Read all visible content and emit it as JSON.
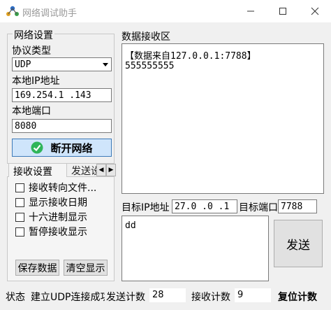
{
  "window": {
    "title": "网络调试助手"
  },
  "network_settings": {
    "group_title": "网络设置",
    "protocol_label": "协议类型",
    "protocol_value": "UDP",
    "local_ip_label": "本地IP地址",
    "local_ip_value": "169.254.1  .143",
    "local_port_label": "本地端口",
    "local_port_value": "8080",
    "connect_button": "断开网络"
  },
  "receive_settings": {
    "tab_active": "接收设置",
    "tab_inactive": "发送设置",
    "options": [
      "接收转向文件...",
      "显示接收日期",
      "十六进制显示",
      "暂停接收显示"
    ],
    "save_button": "保存数据",
    "clear_button": "清空显示"
  },
  "receive_area": {
    "title": "数据接收区",
    "lines": [
      "【数据来自127.0.0.1:7788】",
      "555555555"
    ]
  },
  "target": {
    "ip_label": "目标IP地址",
    "ip_value": "27.0  .0  .1",
    "port_label": "目标端口",
    "port_value": "7788"
  },
  "send_area": {
    "text": "dd",
    "send_button": "发送"
  },
  "status_bar": {
    "status_label": "状态",
    "status_text": "建立UDP连接成功",
    "send_count_label": "发送计数",
    "send_count_value": "28",
    "recv_count_label": "接收计数",
    "recv_count_value": "9",
    "reset_button": "复位计数"
  },
  "colors": {
    "connect_button_bg": "#cfe5fb",
    "connect_icon": "#2fb55a"
  }
}
